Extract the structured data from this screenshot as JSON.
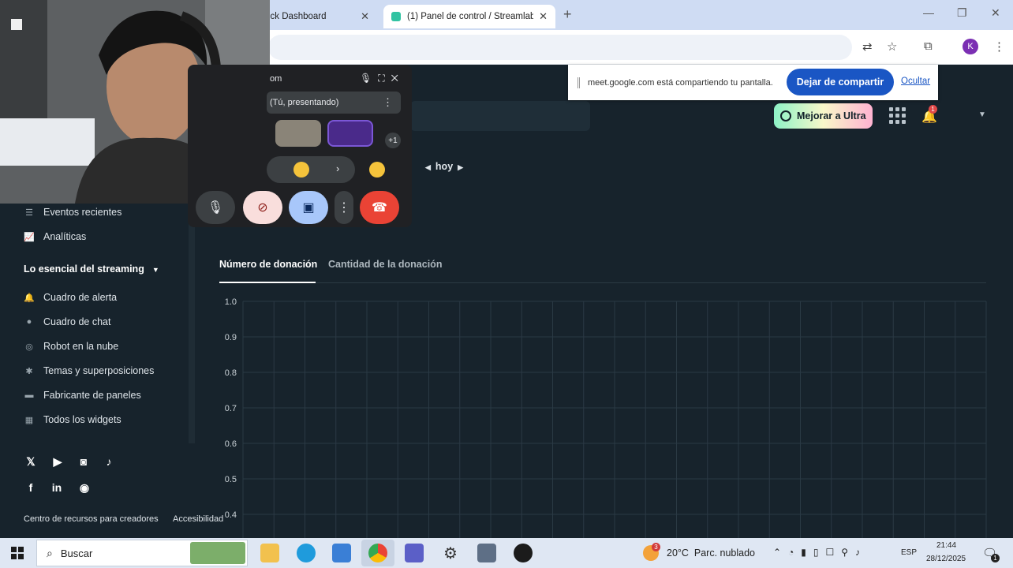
{
  "browser": {
    "tabs": [
      {
        "title": "ick Dashboard",
        "active": false
      },
      {
        "title": "(1) Panel de control / Streamlab",
        "active": true
      }
    ],
    "new_tab": "+",
    "profile_initial": "K"
  },
  "share_banner": {
    "text": "meet.google.com está compartiendo tu pantalla.",
    "stop_button": "Dejar de compartir",
    "hide_link": "Ocultar"
  },
  "header": {
    "upgrade_button": "Mejorar a Ultra",
    "notification_count": "1"
  },
  "date_nav": {
    "label": "hoy"
  },
  "sidebar": {
    "items_top": [
      {
        "label": "Eventos recientes",
        "icon": "list-icon"
      },
      {
        "label": "Analíticas",
        "icon": "analytics-icon"
      }
    ],
    "section_title": "Lo esencial del streaming",
    "items": [
      {
        "label": "Cuadro de alerta",
        "icon": "bell-icon"
      },
      {
        "label": "Cuadro de chat",
        "icon": "chat-icon"
      },
      {
        "label": "Robot en la nube",
        "icon": "robot-icon"
      },
      {
        "label": "Temas y superposiciones",
        "icon": "themes-icon"
      },
      {
        "label": "Fabricante de paneles",
        "icon": "panels-icon"
      },
      {
        "label": "Todos los widgets",
        "icon": "widgets-icon"
      }
    ],
    "social_icons": [
      "x-icon",
      "youtube-icon",
      "instagram-icon",
      "tiktok-icon",
      "facebook-icon",
      "linkedin-icon",
      "discord-icon"
    ],
    "footer": [
      "Centro de recursos para creadores",
      "Accesibilidad"
    ]
  },
  "metrics": {
    "tabs": [
      "Número de donación",
      "Cantidad de la donación"
    ],
    "active_tab": 0
  },
  "chart_data": {
    "type": "line",
    "y_ticks": [
      "1.0",
      "0.9",
      "0.8",
      "0.7",
      "0.6",
      "0.5",
      "0.4"
    ],
    "ylim": [
      0.4,
      1.0
    ],
    "series": [],
    "grid": true
  },
  "meet_panel": {
    "title": "om",
    "presenting_label": "(Tú, presentando)",
    "extra_participants": "+1"
  },
  "taskbar": {
    "search_placeholder": "Buscar",
    "weather": "20°C  Parc. nublado",
    "weather_badge": "3",
    "language": "ESP",
    "time": "21:44",
    "date": "28/12/2025",
    "notifications": "1"
  },
  "colors": {
    "page_bg": "#17232c",
    "accent_blue": "#1a56c4",
    "end_call_red": "#ea4335",
    "share_button": "#a8c7fa"
  }
}
